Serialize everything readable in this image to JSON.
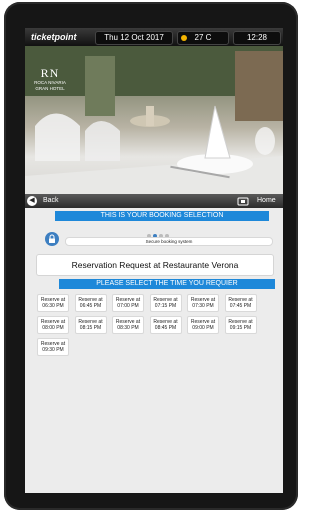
{
  "topbar": {
    "brand": "ticketpoint",
    "date": "Thu 12 Oct 2017",
    "temperature": "27 C",
    "time": "12:28",
    "weather_icon": "sun-icon"
  },
  "hotel": {
    "monogram": "RN",
    "name": "ROCA NIVARIA",
    "subtitle": "GRAN HOTEL"
  },
  "nav": {
    "back_label": "Back",
    "home_label": "Home"
  },
  "booking": {
    "banner": "THIS IS YOUR BOOKING SELECTION",
    "step_current": 2,
    "secure_text": "Secure booking system",
    "restaurant_title": "Reservation Request at Restaurante Verona",
    "time_banner": "PLEASE SELECT THE TIME YOU REQUIER"
  },
  "time_slots": [
    {
      "line1": "Reserve at",
      "line2": "06:30 PM"
    },
    {
      "line1": "Reserve at",
      "line2": "06:45 PM"
    },
    {
      "line1": "Reserve at",
      "line2": "07:00 PM"
    },
    {
      "line1": "Reserve at",
      "line2": "07:15 PM"
    },
    {
      "line1": "Reserve at",
      "line2": "07:30 PM"
    },
    {
      "line1": "Reserve at",
      "line2": "07:45 PM"
    },
    {
      "line1": "Reserve at",
      "line2": "08:00 PM"
    },
    {
      "line1": "Reserve at",
      "line2": "08:15 PM"
    },
    {
      "line1": "Reserve at",
      "line2": "08:30 PM"
    },
    {
      "line1": "Reserve at",
      "line2": "08:45 PM"
    },
    {
      "line1": "Reserve at",
      "line2": "09:00 PM"
    },
    {
      "line1": "Reserve at",
      "line2": "09:15 PM"
    },
    {
      "line1": "Reserve at",
      "line2": "09:30 PM"
    }
  ],
  "colors": {
    "accent": "#1e88d9",
    "lock": "#3d7fc1"
  }
}
